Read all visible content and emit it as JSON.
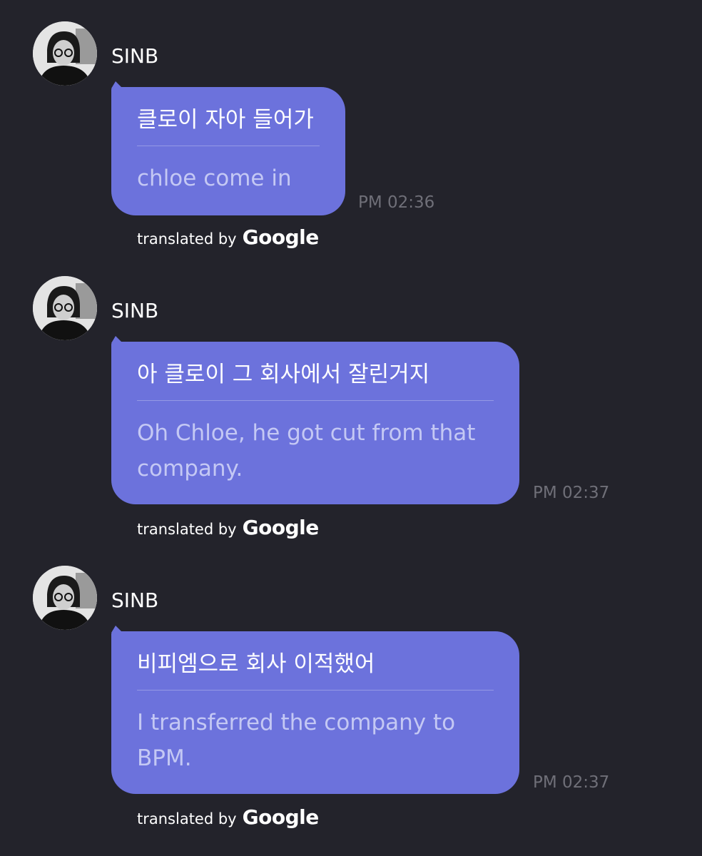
{
  "messages": [
    {
      "sender": "SINB",
      "original": "클로이 자아 들어가",
      "translation": "chloe come in",
      "time": "PM 02:36",
      "credit_prefix": "translated by",
      "credit_brand": "Google",
      "avatar_icon": "profile-photo-icon"
    },
    {
      "sender": "SINB",
      "original": "아 클로이 그 회사에서 잘린거지",
      "translation": "Oh Chloe, he got cut from that company.",
      "time": "PM 02:37",
      "credit_prefix": "translated by",
      "credit_brand": "Google",
      "avatar_icon": "profile-photo-icon"
    },
    {
      "sender": "SINB",
      "original": "비피엠으로 회사 이적했어",
      "translation": "I transferred the company to BPM.",
      "time": "PM 02:37",
      "credit_prefix": "translated by",
      "credit_brand": "Google",
      "avatar_icon": "profile-photo-icon"
    }
  ],
  "colors": {
    "background": "#23232b",
    "bubble": "#6c72dc",
    "translation_text": "#c4c8f4",
    "timestamp": "#6f6f78"
  }
}
